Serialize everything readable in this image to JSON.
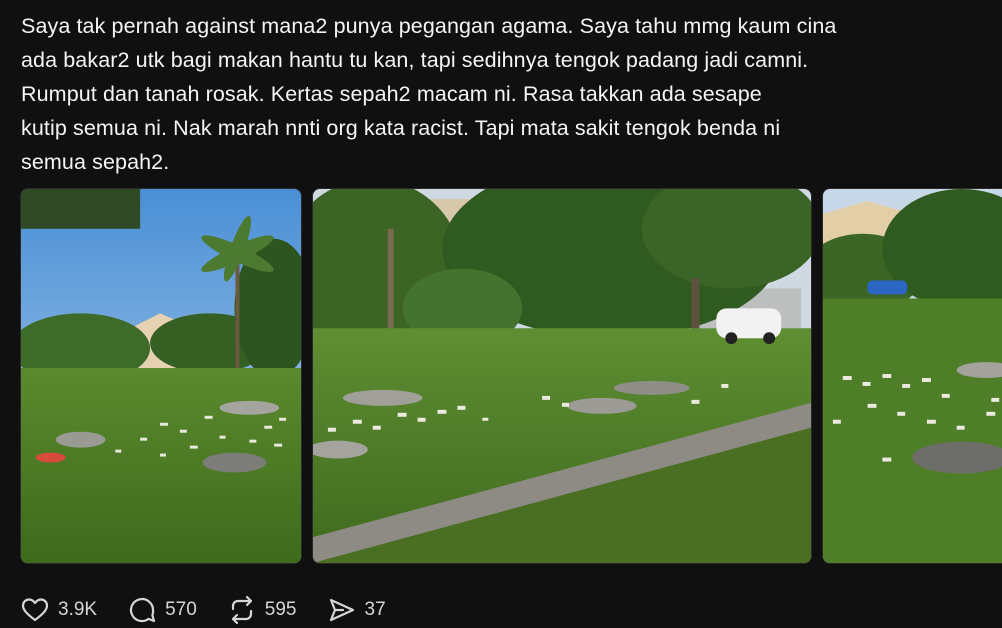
{
  "post": {
    "text": "Saya tak pernah against mana2 punya pegangan agama. Saya tahu mmg kaum cina\nada bakar2 utk bagi makan hantu tu kan, tapi sedihnya tengok padang jadi camni.\nRumput dan tanah rosak. Kertas sepah2 macam ni. Rasa takkan ada sesape\nkutip semua ni. Nak marah nnti org kata racist. Tapi mata sakit tengok benda ni\nsemua sepah2."
  },
  "actions": {
    "likes": "3.9K",
    "replies": "570",
    "reposts": "595",
    "shares": "37"
  },
  "colors": {
    "background": "#101010",
    "text": "#f3f5f7",
    "icon": "#d6d6d6"
  }
}
